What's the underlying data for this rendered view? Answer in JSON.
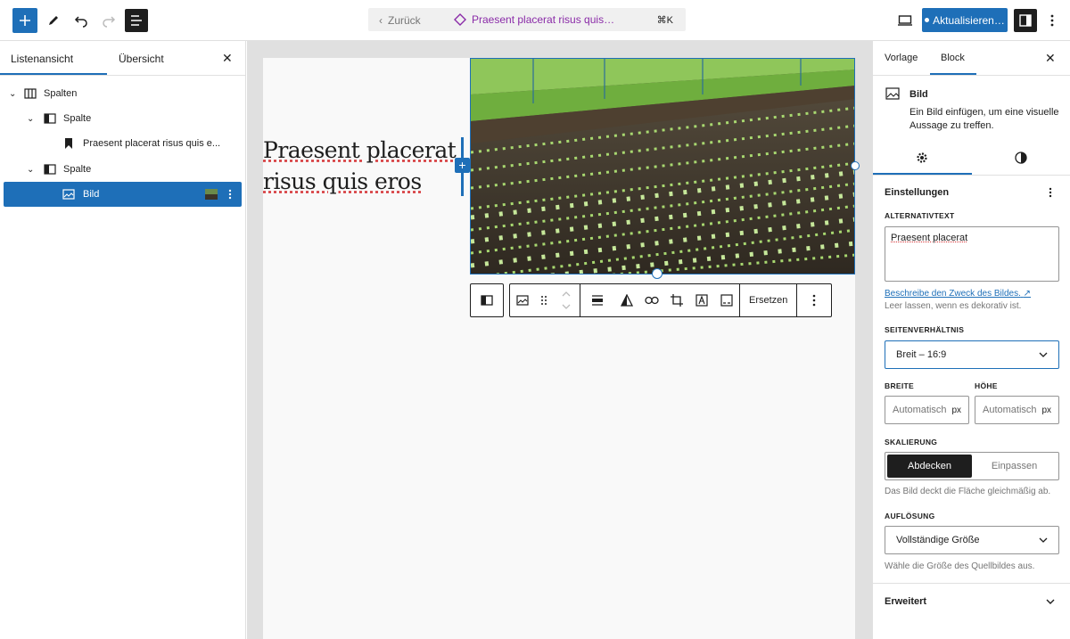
{
  "topbar": {
    "back_label": "Zurück",
    "doc_title": "Praesent placerat risus quis…",
    "shortcut": "⌘K",
    "update_label": "Aktualisieren…"
  },
  "left_panel": {
    "tab_list": "Listenansicht",
    "tab_overview": "Übersicht",
    "tree": [
      {
        "label": "Spalten"
      },
      {
        "label": "Spalte"
      },
      {
        "label": "Praesent placerat risus quis e..."
      },
      {
        "label": "Spalte"
      },
      {
        "label": "Bild"
      }
    ]
  },
  "canvas": {
    "heading": "Praesent placerat risus quis eros",
    "toolbar": {
      "replace_label": "Ersetzen"
    }
  },
  "right_panel": {
    "tab_template": "Vorlage",
    "tab_block": "Block",
    "block": {
      "name": "Bild",
      "description": "Ein Bild einfügen, um eine visuelle Aussage zu treffen."
    },
    "settings_title": "Einstellungen",
    "alt": {
      "label": "ALTERNATIVTEXT",
      "value": "Praesent placerat",
      "link": "Beschreibe den Zweck des Bildes.",
      "help": "Leer lassen, wenn es dekorativ ist."
    },
    "aspect": {
      "label": "SEITENVERHÄLTNIS",
      "value": "Breit – 16:9"
    },
    "width": {
      "label": "BREITE",
      "placeholder": "Automatisch",
      "unit": "px"
    },
    "height": {
      "label": "HÖHE",
      "placeholder": "Automatisch",
      "unit": "px"
    },
    "scale": {
      "label": "SKALIERUNG",
      "option_cover": "Abdecken",
      "option_contain": "Einpassen",
      "help": "Das Bild deckt die Fläche gleichmäßig ab."
    },
    "resolution": {
      "label": "AUFLÖSUNG",
      "value": "Vollständige Größe",
      "help": "Wähle die Größe des Quellbildes aus."
    },
    "advanced": "Erweitert"
  },
  "colors": {
    "accent": "#1e6fb8",
    "title_purple": "#8a2ba8"
  }
}
